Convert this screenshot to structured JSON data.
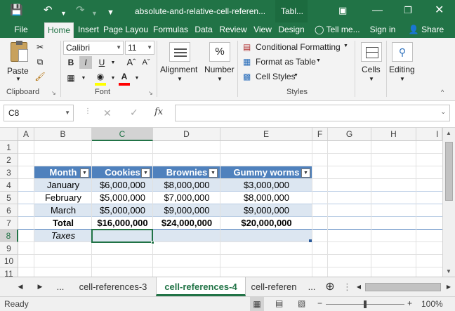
{
  "titlebar": {
    "title": "absolute-and-relative-cell-referen...",
    "context_label": "Tabl...",
    "icons": [
      "save-icon",
      "undo-icon",
      "redo-icon",
      "ribbon-display-icon",
      "minimize-icon",
      "restore-icon",
      "close-icon"
    ]
  },
  "tabs": [
    {
      "label": "File"
    },
    {
      "label": "Home"
    },
    {
      "label": "Insert"
    },
    {
      "label": "Page Layou"
    },
    {
      "label": "Formulas"
    },
    {
      "label": "Data"
    },
    {
      "label": "Review"
    },
    {
      "label": "View"
    },
    {
      "label": "Design"
    }
  ],
  "tell_me": "Tell me...",
  "sign_in": "Sign in",
  "share": "Share",
  "ribbon": {
    "paste": "Paste",
    "clipboard_label": "Clipboard",
    "font_name": "Calibri",
    "font_size": "11",
    "bold": "B",
    "italic": "I",
    "underline": "U",
    "font_label": "Font",
    "alignment": "Alignment",
    "number": "Number",
    "percent": "%",
    "conditional_formatting": "Conditional Formatting",
    "format_as_table": "Format as Table",
    "cell_styles": "Cell Styles",
    "styles_label": "Styles",
    "cells": "Cells",
    "editing": "Editing",
    "accent_color": "#217346",
    "highlight_color": "#ffff00",
    "font_color": "#ff0000"
  },
  "formula_bar": {
    "name_box": "C8",
    "fx": "fx",
    "formula": ""
  },
  "grid": {
    "columns": [
      "A",
      "B",
      "C",
      "D",
      "E",
      "F",
      "G",
      "H",
      "I"
    ],
    "rows": [
      "1",
      "2",
      "3",
      "4",
      "5",
      "6",
      "7",
      "8",
      "9",
      "10",
      "11"
    ],
    "selected_cell": "C8",
    "table": {
      "headers": [
        "Month",
        "Cookies",
        "Brownies",
        "Gummy worms"
      ],
      "rows": [
        [
          "January",
          "$6,000,000",
          "$8,000,000",
          "$3,000,000"
        ],
        [
          "February",
          "$5,000,000",
          "$7,000,000",
          "$8,000,000"
        ],
        [
          "March",
          "$5,000,000",
          "$9,000,000",
          "$9,000,000"
        ]
      ],
      "total": [
        "Total",
        "$16,000,000",
        "$24,000,000",
        "$20,000,000"
      ],
      "taxes_label": "Taxes",
      "header_color": "#4f81bd",
      "band_color": "#dce6f1"
    }
  },
  "sheet_tabs": {
    "ellipsis_left": "...",
    "tabs": [
      "cell-references-3",
      "cell-references-4",
      "cell-referen"
    ],
    "active": "cell-references-4",
    "ellipsis_right": "..."
  },
  "status": {
    "ready": "Ready",
    "zoom": "100%"
  }
}
